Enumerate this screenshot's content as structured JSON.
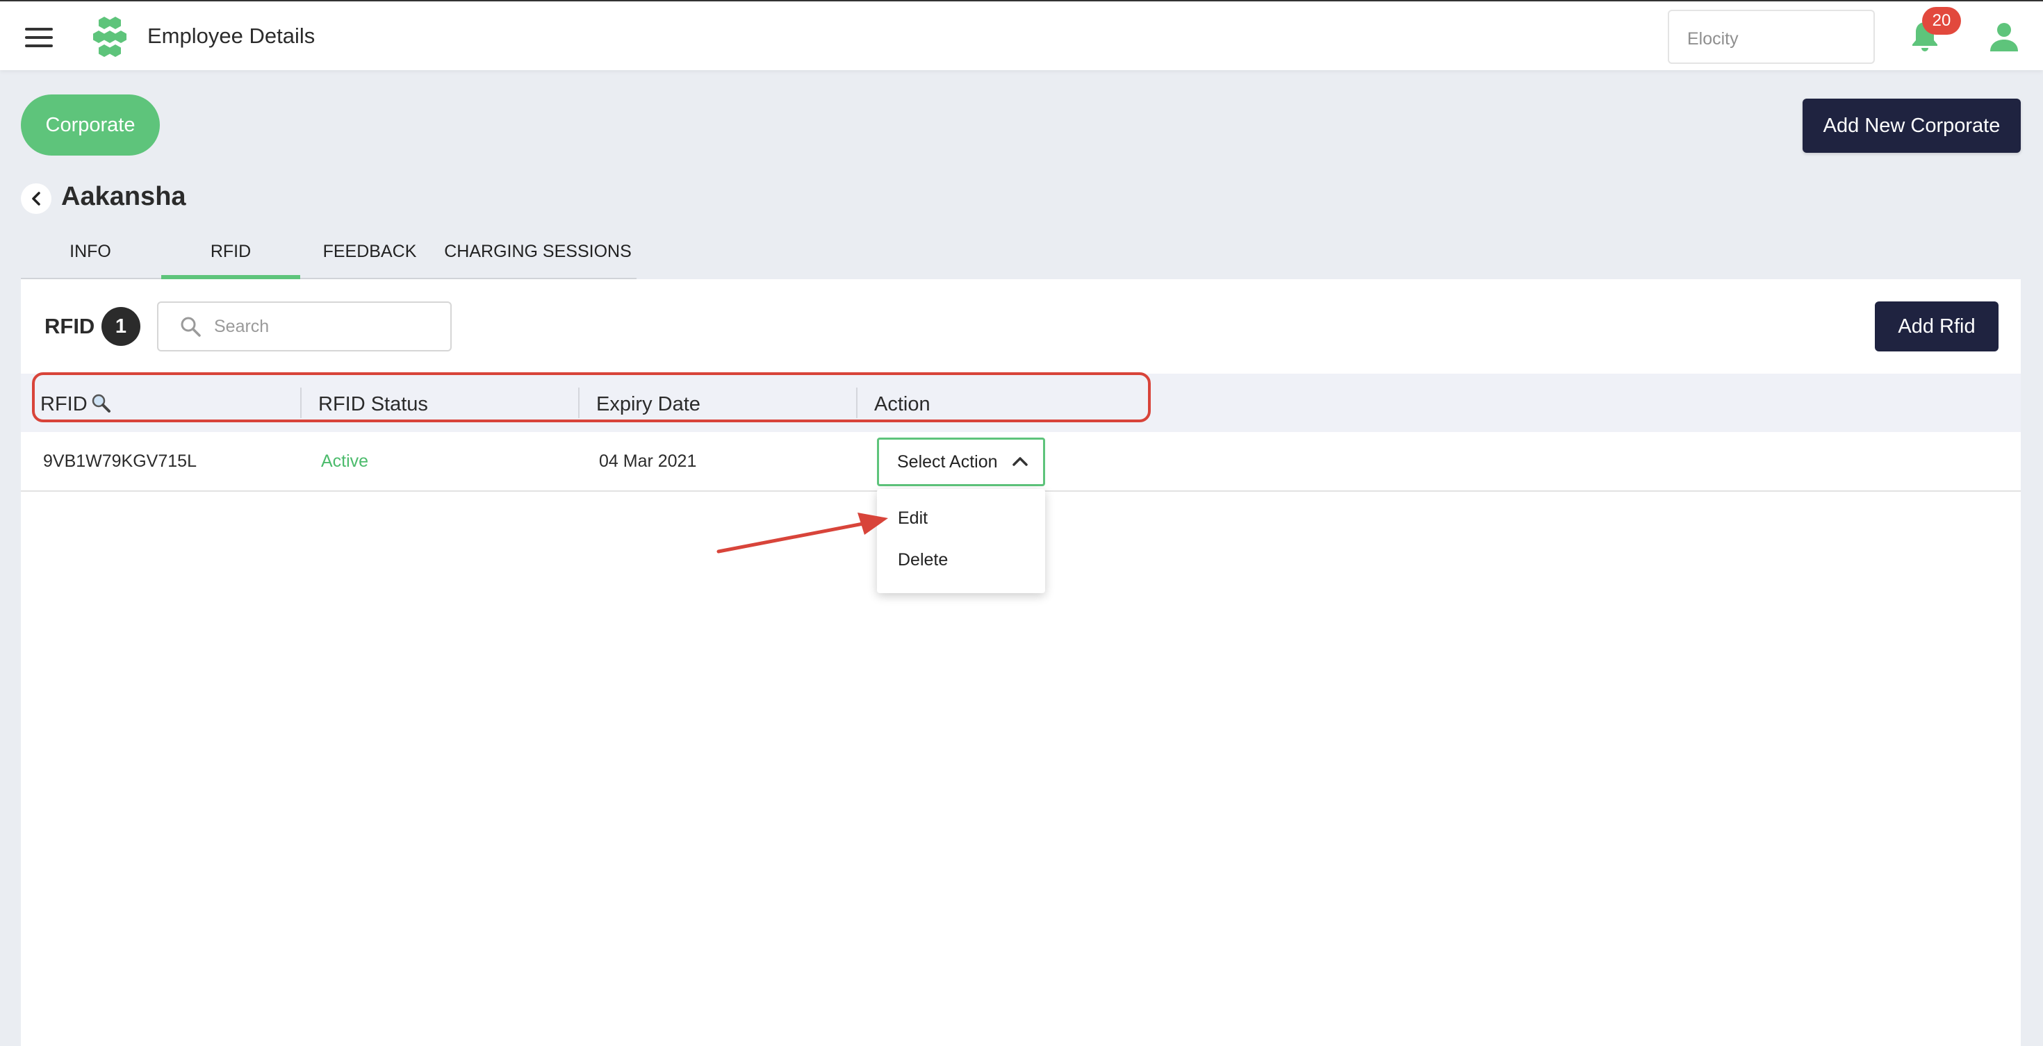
{
  "header": {
    "title": "Employee Details",
    "site_selector_value": "Elocity",
    "notification_count": "20"
  },
  "toolbar": {
    "corporate_label": "Corporate",
    "add_corporate_label": "Add New Corporate"
  },
  "employee": {
    "name": "Aakansha"
  },
  "tabs": [
    {
      "label": "INFO",
      "active": false
    },
    {
      "label": "RFID",
      "active": true
    },
    {
      "label": "FEEDBACK",
      "active": false
    },
    {
      "label": "CHARGING SESSIONS",
      "active": false
    }
  ],
  "rfid_panel": {
    "title": "RFID",
    "count": "1",
    "search_placeholder": "Search",
    "add_button_label": "Add Rfid",
    "columns": [
      "RFID",
      "RFID Status",
      "Expiry Date",
      "Action"
    ],
    "rows": [
      {
        "rfid": "9VB1W79KGV715L",
        "status": "Active",
        "expiry_date": "04 Mar 2021",
        "action_label": "Select Action"
      }
    ],
    "action_menu": [
      "Edit",
      "Delete"
    ]
  },
  "colors": {
    "brand_green": "#5ec47b",
    "dark_navy": "#1f2340",
    "badge_red": "#e2493d",
    "annotation_red": "#d8443a"
  },
  "icons": [
    "menu-icon",
    "logo-icon",
    "bell-icon",
    "user-icon",
    "back-arrow-icon",
    "search-icon",
    "chevron-up-icon"
  ]
}
